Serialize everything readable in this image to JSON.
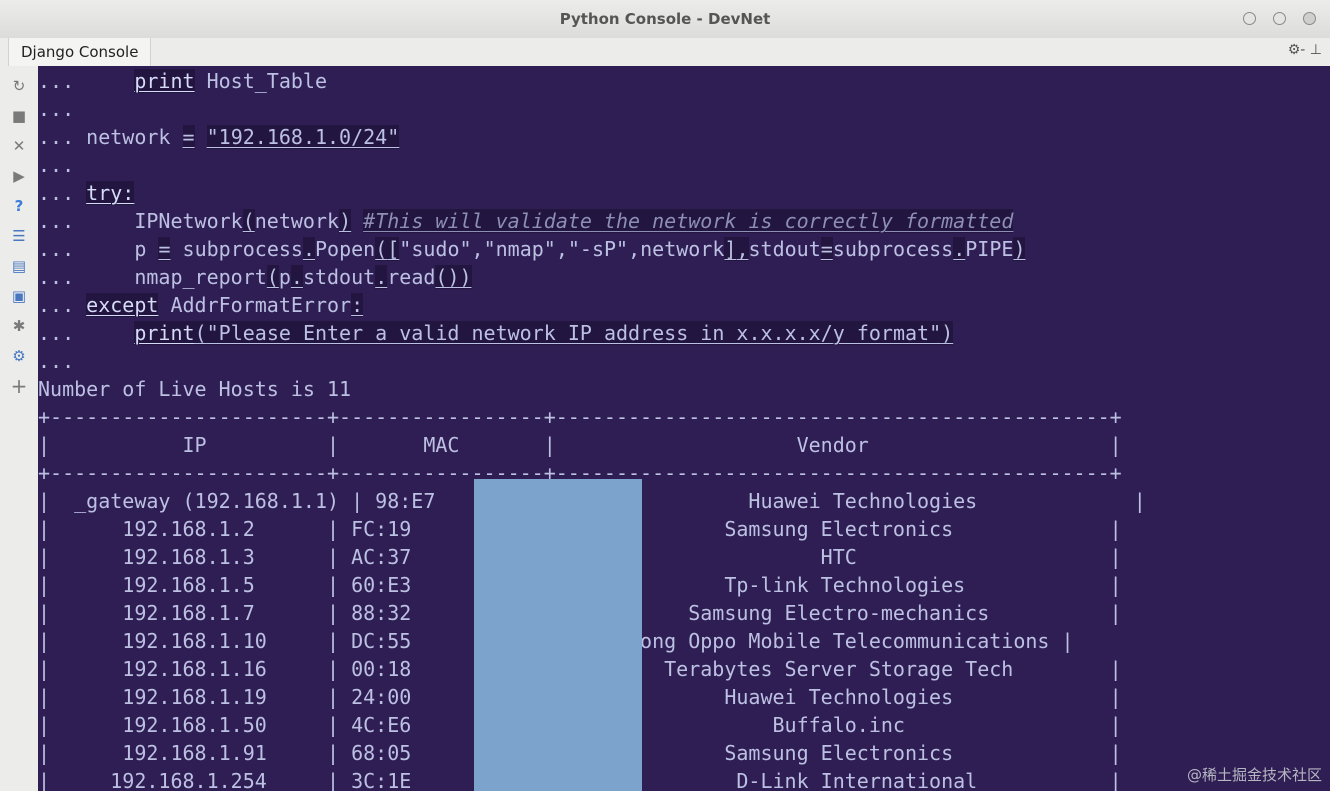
{
  "window": {
    "title": "Python Console - DevNet"
  },
  "tab": {
    "label": "Django Console",
    "tools": "⚙- ⊥"
  },
  "sidebar": {
    "icons": [
      "rerun-icon",
      "stop-icon",
      "close-icon",
      "execute-icon",
      "help-icon",
      "settings-icon",
      "variables-icon",
      "history-icon",
      "debug-icon",
      "gear-icon",
      "add-icon"
    ]
  },
  "code": {
    "prompt": "...",
    "l1_kw": "print",
    "l1_rest": " Host_Table",
    "l3_var": "network",
    "l3_eq": "=",
    "l3_str": "\"192.168.1.0/24\"",
    "l5_kw": "try:",
    "l6_call": "IPNetwork",
    "l6_paren1": "(",
    "l6_arg": "network",
    "l6_paren2": ")",
    "l6_comment": "#This will validate the network is correctly formatted",
    "l7_a": "p ",
    "l7_eq": "=",
    "l7_b": " subprocess",
    "l7_dot": ".",
    "l7_c": "Popen",
    "l7_p": "(",
    "l7_br": "[",
    "l7_list": "\"sudo\",\"nmap\",\"-sP\",network",
    "l7_br2": "]",
    "l7_comma": ",",
    "l7_d": "stdout",
    "l7_eq2": "=",
    "l7_e": "subprocess",
    "l7_dot2": ".",
    "l7_f": "PIPE",
    "l7_p2": ")",
    "l8_a": "nmap_report",
    "l8_p": "(",
    "l8_b": "p",
    "l8_dot": ".",
    "l8_c": "stdout",
    "l8_dot2": ".",
    "l8_d": "read",
    "l8_pp": "())",
    "l9_kw": "except",
    "l9_rest": " AddrFormatError",
    "l9_colon": ":",
    "l10_kw": "print",
    "l10_p": "(",
    "l10_str": "\"Please Enter a valid network IP address in x.x.x.x/y format\"",
    "l10_p2": ")"
  },
  "output": {
    "summary": "Number of Live Hosts is 11",
    "border": "+-----------------------+-----------------+----------------------------------------------+",
    "header_row": "|           IP          |       MAC       |                    Vendor                    |",
    "rows": [
      "|  _gateway (192.168.1.1) | 98:E7           |              Huawei Technologies             |",
      "|      192.168.1.2      | FC:19           |              Samsung Electronics             |",
      "|      192.168.1.3      | AC:37           |                      HTC                     |",
      "|      192.168.1.5      | 60:E3           |              Tp-link Technologies            |",
      "|      192.168.1.7      | 88:32           |           Samsung Electro-mechanics          |",
      "|      192.168.1.10     | DC:55           | Guangdong Oppo Mobile Telecommunications |",
      "|      192.168.1.16     | 00:18           |         Terabytes Server Storage Tech        |",
      "|      192.168.1.19     | 24:00           |              Huawei Technologies             |",
      "|      192.168.1.50     | 4C:E6           |                  Buffalo.inc                 |",
      "|      192.168.1.91     | 68:05           |              Samsung Electronics             |",
      "|     192.168.1.254     | 3C:1E           |               D-Link International           |"
    ]
  },
  "watermark": "@稀土掘金技术社区"
}
